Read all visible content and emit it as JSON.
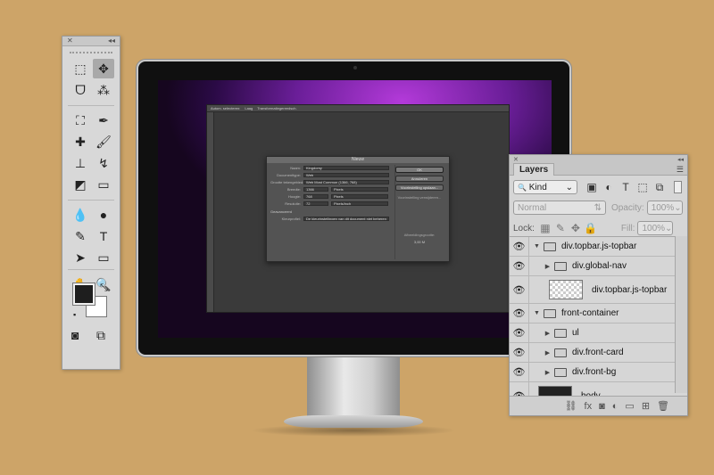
{
  "toolbox": {
    "close_glyph": "✕",
    "collapse_glyph": "◂◂",
    "tools": [
      {
        "icon": "rectangular-marquee-icon",
        "glyph": "⬚"
      },
      {
        "icon": "move-icon",
        "glyph": "✥",
        "selected": true
      },
      {
        "icon": "lasso-icon",
        "glyph": "ᗜ"
      },
      {
        "icon": "magic-wand-icon",
        "glyph": "⁂"
      },
      {
        "icon": "crop-icon",
        "glyph": "⛶"
      },
      {
        "icon": "eyedropper-icon",
        "glyph": "✒"
      },
      {
        "icon": "healing-brush-icon",
        "glyph": "✚"
      },
      {
        "icon": "brush-icon",
        "glyph": "🖌"
      },
      {
        "icon": "clone-stamp-icon",
        "glyph": "⊥"
      },
      {
        "icon": "history-brush-icon",
        "glyph": "↯"
      },
      {
        "icon": "eraser-icon",
        "glyph": "◩"
      },
      {
        "icon": "gradient-icon",
        "glyph": "▭"
      },
      {
        "icon": "blur-icon",
        "glyph": "💧"
      },
      {
        "icon": "dodge-icon",
        "glyph": "●"
      },
      {
        "icon": "pen-icon",
        "glyph": "✎"
      },
      {
        "icon": "type-icon",
        "glyph": "T"
      },
      {
        "icon": "path-selection-icon",
        "glyph": "➤"
      },
      {
        "icon": "rectangle-shape-icon",
        "glyph": "▭"
      },
      {
        "icon": "hand-icon",
        "glyph": "✋"
      },
      {
        "icon": "zoom-icon",
        "glyph": "🔍"
      }
    ],
    "foreground_color": "#1e1e1e",
    "background_color": "#ffffff",
    "swap_glyph": "⤡",
    "default_colors_glyph": "▪",
    "quick_mask_glyph": "◙",
    "screen_mode_glyph": "⧉"
  },
  "monitor": {
    "options_bar": [
      "Autom. selecteren:",
      "Laag",
      "Transformatiegereedsch."
    ],
    "dialog": {
      "title": "Nieuw",
      "name_label": "Naam:",
      "name_value": "Kingdomy",
      "doctype_label": "Documenttype:",
      "doctype_value": "Web",
      "size_label": "Grootte tekengebied:",
      "size_value": "Web Most Common (1366, 768)",
      "width_label": "Breedte:",
      "width_value": "1366",
      "width_unit": "Pixels",
      "height_label": "Hoogte:",
      "height_value": "768",
      "height_unit": "Pixels",
      "resolution_label": "Resolutie:",
      "resolution_value": "72",
      "resolution_unit": "Pixels/inch",
      "advanced_label": "Geavanceerd",
      "color_profile_label": "Kleurprofiel:",
      "color_profile_value": "De kleurinstellingen van dit document niet beheren",
      "ok": "OK",
      "cancel": "Annuleren",
      "save_preset": "Voorinstelling opslaan...",
      "delete_preset": "Voorinstelling verwijderen...",
      "image_size_label": "Afbeeldingsgrootte:",
      "image_size_value": "3,00 M"
    }
  },
  "layers_panel": {
    "close_glyph": "✕",
    "collapse_glyph": "◂◂",
    "tab": "Layers",
    "menu_glyph": "☰",
    "filter": {
      "label": "Kind",
      "prefix_glyph": "🔍",
      "arrow": "⌄"
    },
    "filter_icons": [
      {
        "icon": "image-filter-icon",
        "glyph": "▣"
      },
      {
        "icon": "adjustment-filter-icon",
        "glyph": "◐"
      },
      {
        "icon": "type-filter-icon",
        "glyph": "T"
      },
      {
        "icon": "shape-filter-icon",
        "glyph": "⬚"
      },
      {
        "icon": "smart-object-filter-icon",
        "glyph": "⧉"
      }
    ],
    "blend_mode": "Normal",
    "opacity_label": "Opacity:",
    "opacity_value": "100%",
    "lock_label": "Lock:",
    "lock_icons": [
      {
        "icon": "lock-transparent-icon",
        "glyph": "▦"
      },
      {
        "icon": "lock-image-icon",
        "glyph": "✎"
      },
      {
        "icon": "lock-position-icon",
        "glyph": "✥"
      },
      {
        "icon": "lock-all-icon",
        "glyph": "🔒"
      }
    ],
    "fill_label": "Fill:",
    "fill_value": "100%",
    "layers": [
      {
        "name": "div.topbar.js-topbar",
        "type": "group",
        "expanded": true,
        "indent": 0
      },
      {
        "name": "div.global-nav",
        "type": "group",
        "expanded": false,
        "indent": 1
      },
      {
        "name": "div.topbar.js-topbar",
        "type": "layer",
        "thumb": "transparent",
        "indent": 1
      },
      {
        "name": "front-container",
        "type": "group",
        "expanded": true,
        "indent": 0
      },
      {
        "name": "ul",
        "type": "group",
        "expanded": false,
        "indent": 1
      },
      {
        "name": "div.front-card",
        "type": "group",
        "expanded": false,
        "indent": 1
      },
      {
        "name": "div.front-bg",
        "type": "group",
        "expanded": false,
        "indent": 1
      },
      {
        "name": "body",
        "type": "layer",
        "thumb": "dark",
        "indent": 0
      }
    ],
    "eye_glyph": "👁",
    "bottom_icons": [
      {
        "icon": "link-layers-icon",
        "glyph": "⛓"
      },
      {
        "icon": "layer-style-icon",
        "glyph": "fx"
      },
      {
        "icon": "add-mask-icon",
        "glyph": "◙"
      },
      {
        "icon": "adjustment-layer-icon",
        "glyph": "◐"
      },
      {
        "icon": "new-group-icon",
        "glyph": "▭"
      },
      {
        "icon": "new-layer-icon",
        "glyph": "⊞"
      },
      {
        "icon": "delete-layer-icon",
        "glyph": "🗑"
      }
    ]
  }
}
